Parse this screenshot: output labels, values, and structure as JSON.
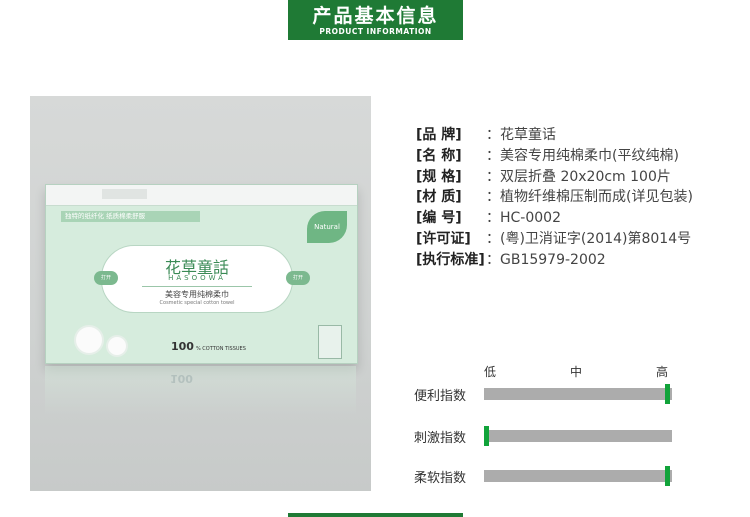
{
  "header": {
    "title_cn": "产品基本信息",
    "title_en": "PRODUCT INFORMATION"
  },
  "product_image": {
    "box_tag": "独特的纸纤化 纸质棉柔舒服",
    "brand_cn": "花草童話",
    "brand_pinyin": "HASOOWA",
    "product_cn": "美容专用纯棉柔巾",
    "product_en": "Cosmetic special cotton towel",
    "count_label": "100",
    "count_small": "% COTTON TISSUES",
    "natural_label": "Natural",
    "left_pill": "打开",
    "right_pill": "打开"
  },
  "specs": [
    {
      "label": "[品    牌]",
      "value": "：花草童话"
    },
    {
      "label": "[名    称]",
      "value": "：美容专用纯棉柔巾(平纹纯棉)"
    },
    {
      "label": "[规    格]",
      "value": "：双层折叠 20x20cm 100片"
    },
    {
      "label": "[材    质]",
      "value": "：植物纤维棉压制而成(详见包装)"
    },
    {
      "label": "[编    号]",
      "value": "：HC-0002"
    },
    {
      "label": "[许可证]",
      "value": "：(粤)卫消证字(2014)第8014号"
    },
    {
      "label": "[执行标准]",
      "value": "：GB15979-2002"
    }
  ],
  "scale": {
    "low": "低",
    "mid": "中",
    "high": "高"
  },
  "indices": [
    {
      "name": "便利指数",
      "level": 1.0
    },
    {
      "name": "刺激指数",
      "level": 0.0
    },
    {
      "name": "柔软指数",
      "level": 1.0
    }
  ],
  "colors": {
    "brand_green": "#1f7a35",
    "marker_green": "#11a33a",
    "bar_gray": "#acacac"
  }
}
